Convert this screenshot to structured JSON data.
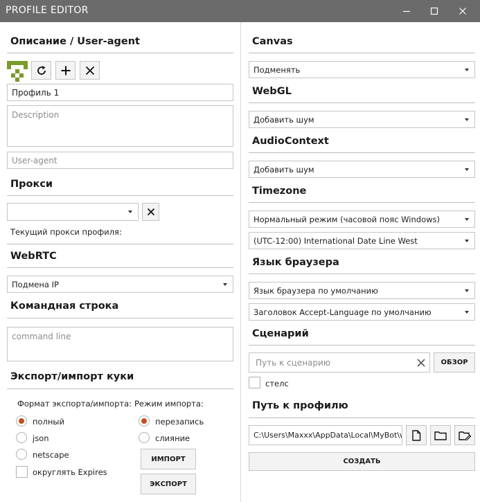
{
  "window": {
    "title": "PROFILE EDITOR"
  },
  "left": {
    "desc_heading": "Описание / User-agent",
    "profile_name": "Профиль 1",
    "description_placeholder": "Description",
    "useragent_placeholder": "User-agent",
    "proxy_heading": "Прокси",
    "proxy_value": "",
    "proxy_current": "Текущий прокси профиля:",
    "webrtc_heading": "WebRTC",
    "webrtc_value": "Подмена IP",
    "cmd_heading": "Командная строка",
    "cmd_placeholder": "command line",
    "cookies_heading": "Экспорт/импорт куки",
    "format_label": "Формат экспорта/импорта:",
    "formats": [
      "полный",
      "json",
      "netscape"
    ],
    "round_expires": "округлять Expires",
    "mode_label": "Режим импорта:",
    "modes": [
      "перезапись",
      "слияние"
    ],
    "import_label": "ИМПОРТ",
    "export_label": "ЭКСПОРТ"
  },
  "right": {
    "canvas_heading": "Canvas",
    "canvas_value": "Подменять",
    "webgl_heading": "WebGL",
    "webgl_value": "Добавить шум",
    "audio_heading": "AudioContext",
    "audio_value": "Добавить шум",
    "tz_heading": "Timezone",
    "tz_mode": "Нормальный режим (часовой пояс Windows)",
    "tz_zone": "(UTC-12:00) International Date Line West",
    "lang_heading": "Язык браузера",
    "lang_value": "Язык браузера по умолчанию",
    "accept_lang_value": "Заголовок Accept-Language по умолчанию",
    "script_heading": "Сценарий",
    "script_placeholder": "Путь к сценарию",
    "browse_label": "ОБЗОР",
    "stealth_label": "стелс",
    "path_heading": "Путь к профилю",
    "path_value": "C:\\Users\\Maxxx\\AppData\\Local\\MyBot\\w",
    "create_label": "СОЗДАТЬ"
  },
  "colors": {
    "titlebar": "#6b6b6b",
    "radio_accent": "#c0501f",
    "avatar": "#7a9a2a"
  }
}
